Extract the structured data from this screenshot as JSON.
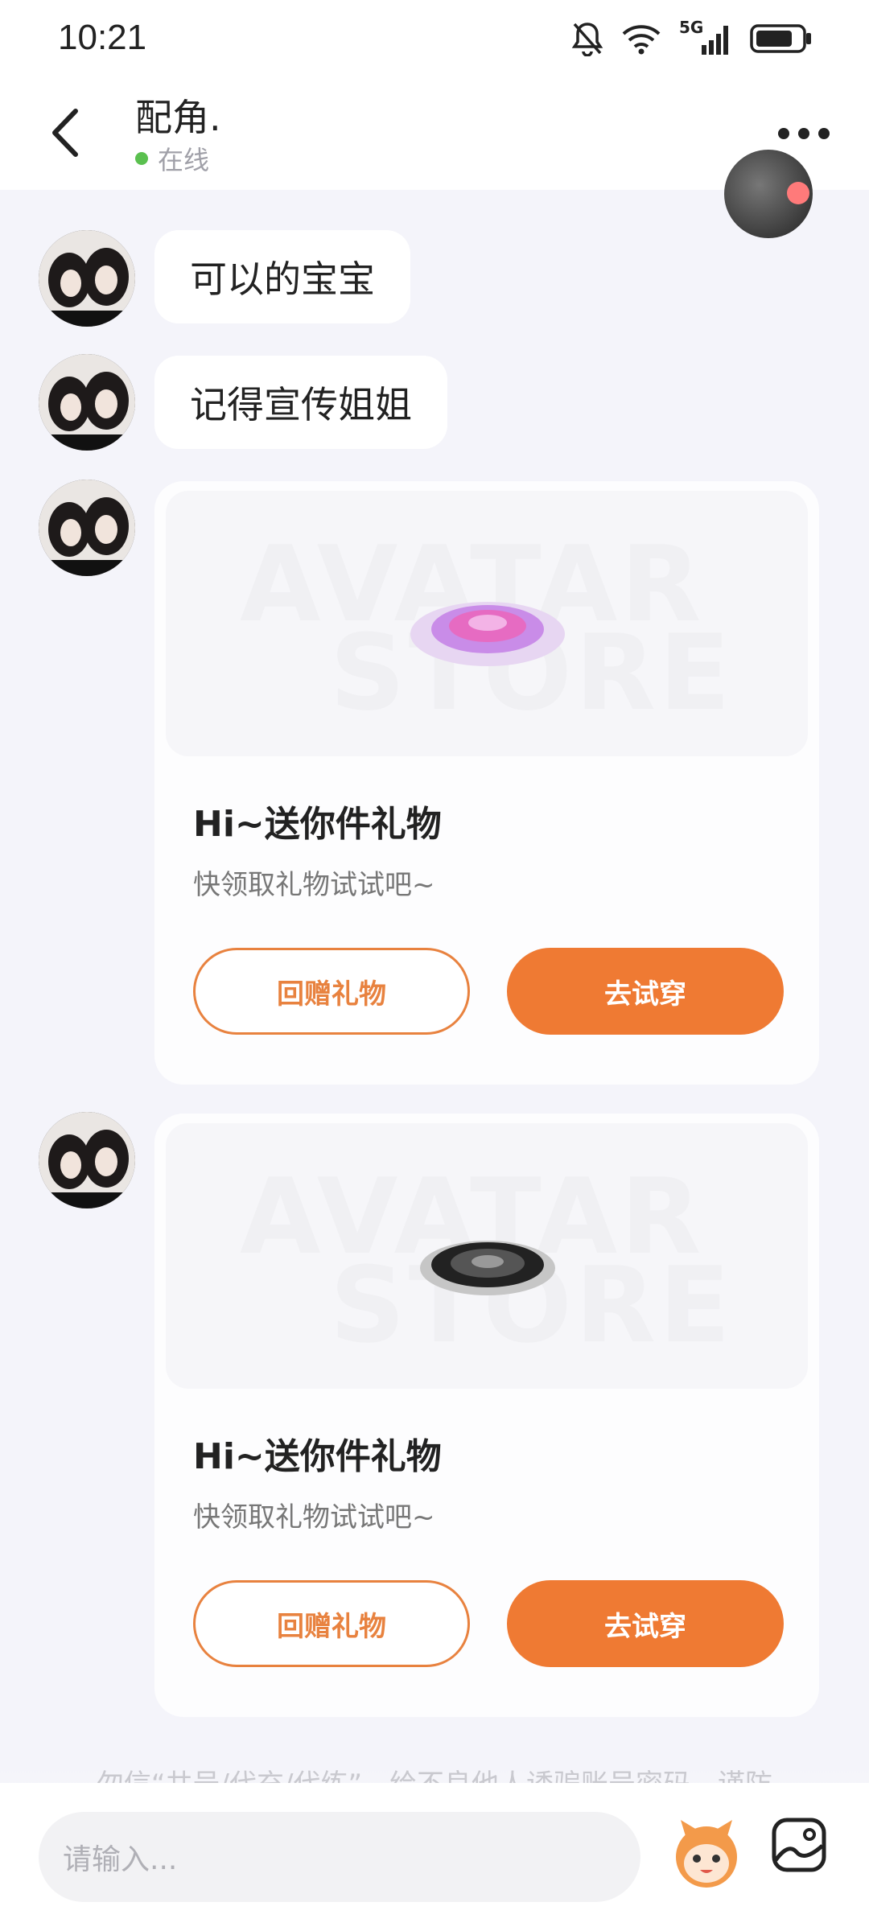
{
  "status_bar": {
    "time": "10:21",
    "network": "5G"
  },
  "header": {
    "title": "配角.",
    "presence": "在线"
  },
  "messages": [
    {
      "text": "可以的宝宝"
    },
    {
      "text": "记得宣传姐姐"
    }
  ],
  "gift_cards": [
    {
      "watermark_top": "AVATAR",
      "watermark_bottom": "STORE",
      "title": "Hi~送你件礼物",
      "subtitle": "快领取礼物试试吧~",
      "return_label": "回赠礼物",
      "try_label": "去试穿",
      "item_color": "#b06ae0"
    },
    {
      "watermark_top": "AVATAR",
      "watermark_bottom": "STORE",
      "title": "Hi~送你件礼物",
      "subtitle": "快领取礼物试试吧~",
      "return_label": "回赠礼物",
      "try_label": "去试穿",
      "item_color": "#333333"
    }
  ],
  "notice": "勿信“共号/代充/代练”，给不良他人诱骗账号密码，谨防",
  "composer": {
    "placeholder": "请输入..."
  },
  "colors": {
    "accent": "#ef7a33",
    "online": "#5ac04f"
  }
}
